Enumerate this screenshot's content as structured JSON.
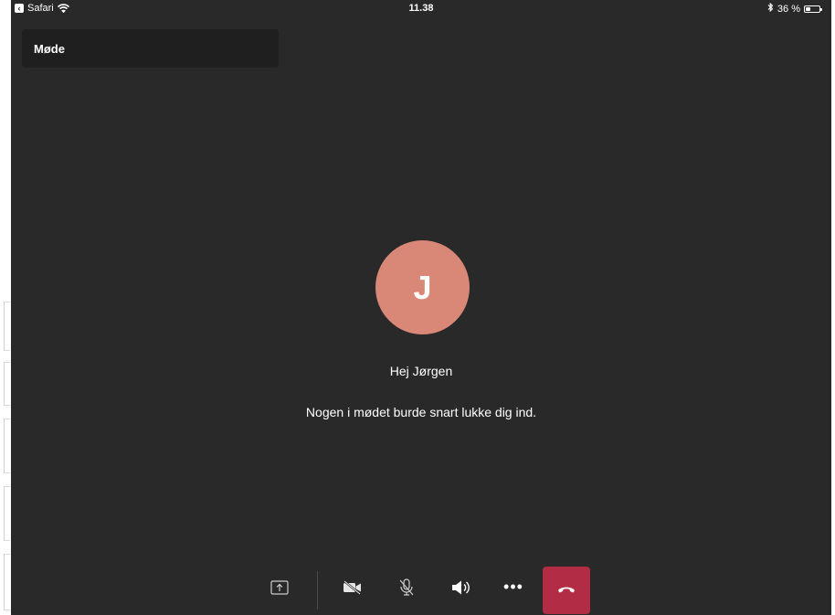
{
  "status_bar": {
    "back_app": "Safari",
    "time": "11.38",
    "battery_percent": "36 %",
    "battery_level": 0.36
  },
  "meeting": {
    "title": "Møde"
  },
  "lobby": {
    "avatar_initial": "J",
    "avatar_color": "#d98878",
    "greeting": "Hej Jørgen",
    "message": "Nogen i mødet burde snart lukke dig ind."
  },
  "toolbar": {
    "icons": {
      "share": "share-screen-icon",
      "camera": "camera-off-icon",
      "mic": "mic-off-icon",
      "speaker": "speaker-icon",
      "more": "more-options-icon",
      "hangup": "hang-up-icon"
    },
    "more_label": "•••",
    "hangup_color": "#b32c45"
  },
  "colors": {
    "background": "#292929",
    "header_bg": "#1f1f1f",
    "text": "#ffffff"
  }
}
